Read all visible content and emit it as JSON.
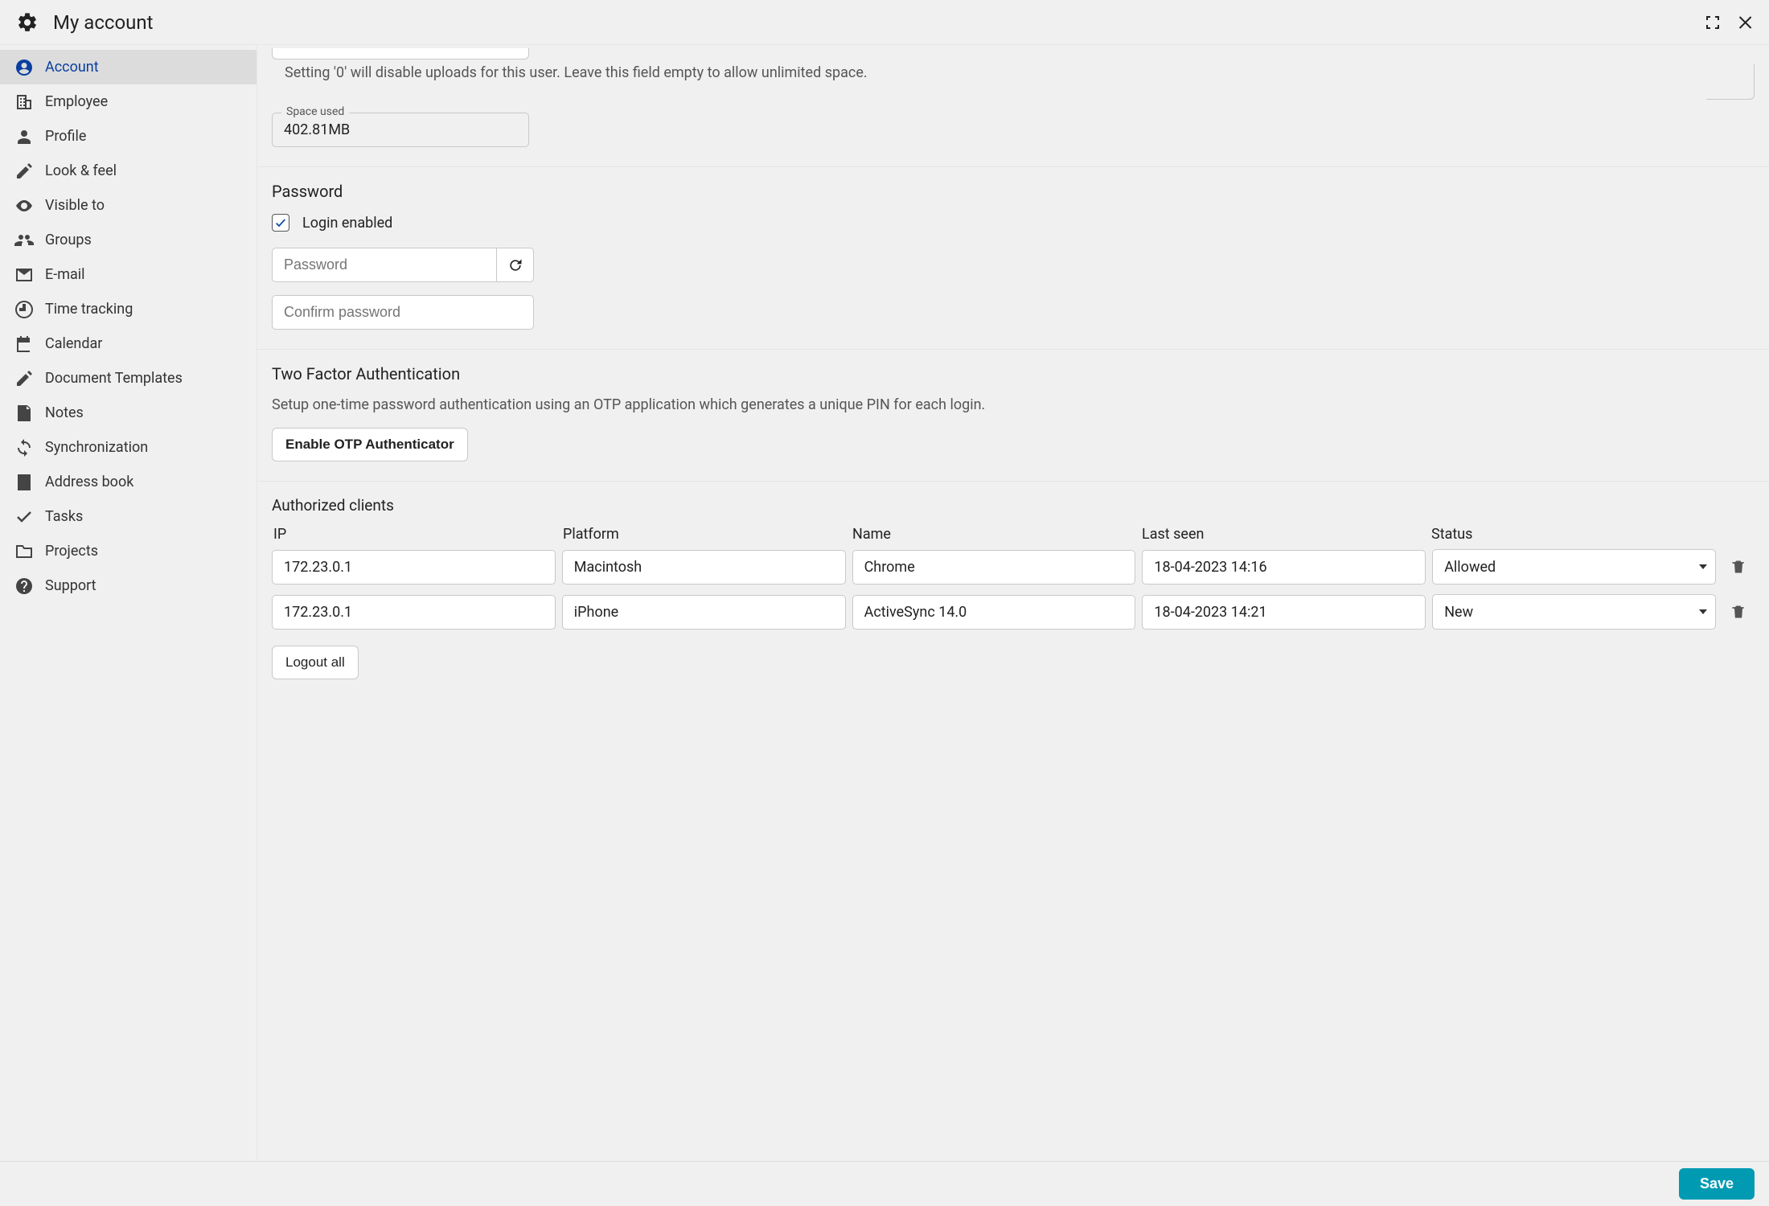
{
  "header": {
    "title": "My account"
  },
  "sidebar": {
    "items": [
      {
        "label": "Account",
        "icon": "account-circle",
        "active": true
      },
      {
        "label": "Employee",
        "icon": "building"
      },
      {
        "label": "Profile",
        "icon": "person"
      },
      {
        "label": "Look & feel",
        "icon": "style"
      },
      {
        "label": "Visible to",
        "icon": "eye"
      },
      {
        "label": "Groups",
        "icon": "group"
      },
      {
        "label": "E-mail",
        "icon": "mail"
      },
      {
        "label": "Time tracking",
        "icon": "clock"
      },
      {
        "label": "Calendar",
        "icon": "calendar"
      },
      {
        "label": "Document Templates",
        "icon": "templates"
      },
      {
        "label": "Notes",
        "icon": "note"
      },
      {
        "label": "Synchronization",
        "icon": "sync"
      },
      {
        "label": "Address book",
        "icon": "contacts"
      },
      {
        "label": "Tasks",
        "icon": "check"
      },
      {
        "label": "Projects",
        "icon": "folder"
      },
      {
        "label": "Support",
        "icon": "help"
      }
    ]
  },
  "main": {
    "disk": {
      "hint": "Setting '0' will disable uploads for this user. Leave this field empty to allow unlimited space.",
      "space_used_label": "Space used",
      "space_used_value": "402.81MB"
    },
    "password": {
      "title": "Password",
      "login_enabled_label": "Login enabled",
      "login_enabled_checked": true,
      "password_placeholder": "Password",
      "confirm_placeholder": "Confirm password"
    },
    "tfa": {
      "title": "Two Factor Authentication",
      "desc": "Setup one-time password authentication using an OTP application which generates a unique PIN for each login.",
      "enable_label": "Enable OTP Authenticator"
    },
    "clients": {
      "title": "Authorized clients",
      "columns": {
        "ip": "IP",
        "platform": "Platform",
        "name": "Name",
        "last_seen": "Last seen",
        "status": "Status"
      },
      "rows": [
        {
          "ip": "172.23.0.1",
          "platform": "Macintosh",
          "name": "Chrome",
          "last_seen": "18-04-2023 14:16",
          "status": "Allowed"
        },
        {
          "ip": "172.23.0.1",
          "platform": "iPhone",
          "name": "ActiveSync 14.0",
          "last_seen": "18-04-2023 14:21",
          "status": "New"
        }
      ],
      "logout_all_label": "Logout all"
    }
  },
  "footer": {
    "save_label": "Save"
  }
}
